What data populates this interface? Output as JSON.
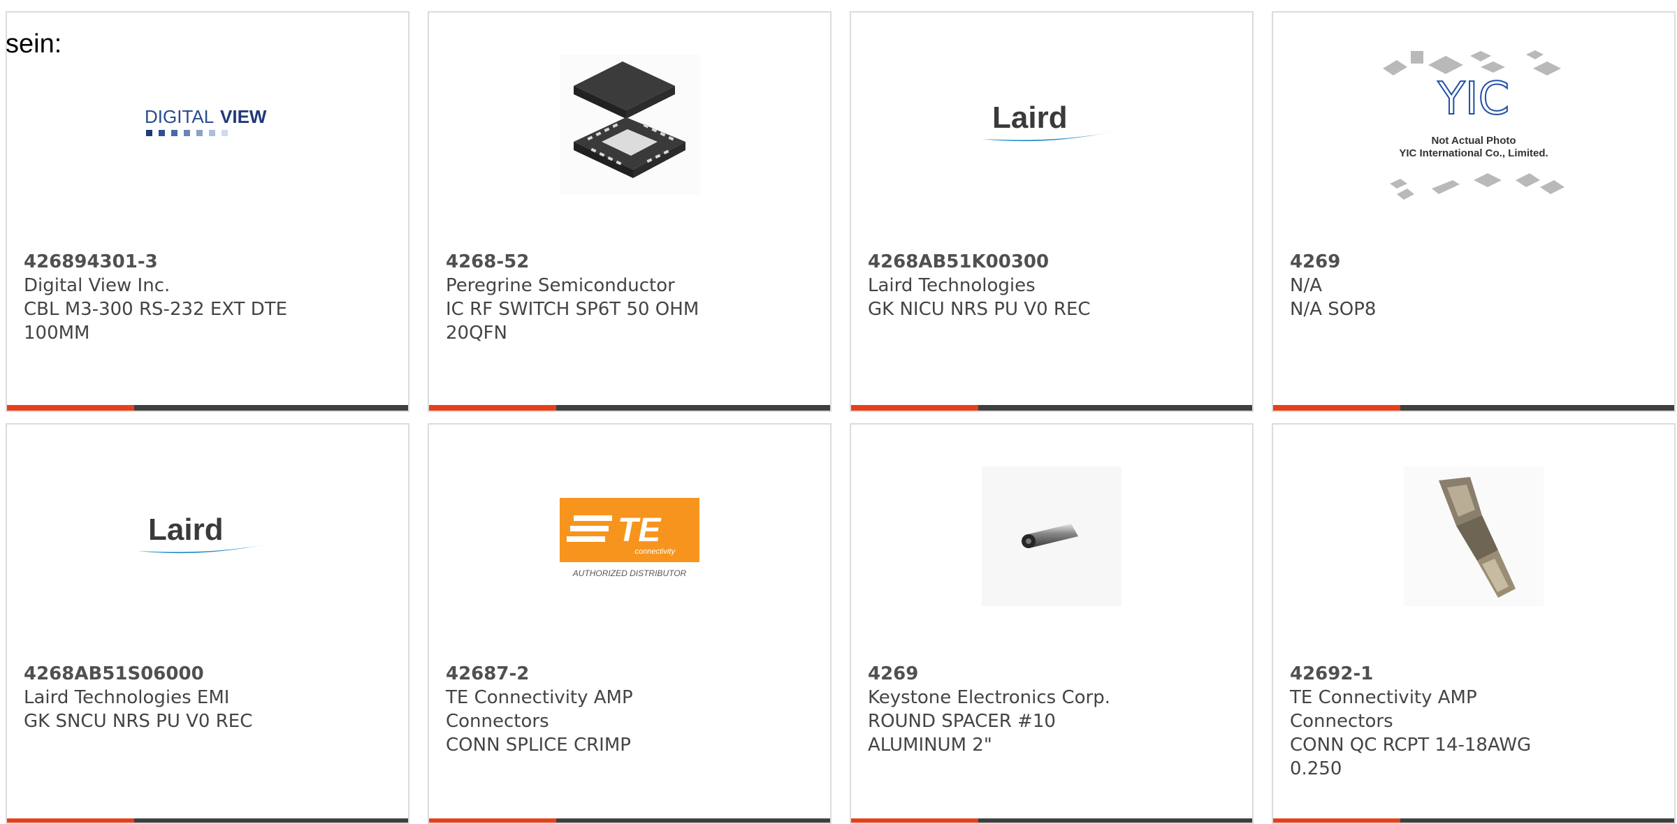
{
  "lead_text": "sein:",
  "colors": {
    "accent": "#e6401a",
    "bar": "#3f3f3f",
    "border": "#dcdcdc",
    "text": "#444444"
  },
  "products": [
    {
      "part_number": "426894301-3",
      "manufacturer": "Digital View Inc.",
      "description": "CBL M3-300 RS-232 EXT DTE 100MM",
      "image": "digitalview-logo",
      "logo_text": {
        "a": "DIGITAL",
        "b": "VIEW"
      }
    },
    {
      "part_number": "4268-52",
      "manufacturer": "Peregrine Semiconductor",
      "description": "IC RF SWITCH SP6T 50 OHM 20QFN",
      "image": "qfn-chip-icon"
    },
    {
      "part_number": "4268AB51K00300",
      "manufacturer": "Laird Technologies",
      "description": "GK NICU NRS PU V0 REC",
      "image": "laird-logo",
      "logo_text": "Laird"
    },
    {
      "part_number": "4269",
      "manufacturer": "N/A",
      "description": "N/A SOP8",
      "image": "yic-placeholder",
      "logo_text": {
        "mark": "YIC",
        "line1": "Not Actual Photo",
        "line2": "YIC International Co., Limited."
      }
    },
    {
      "part_number": "4268AB51S06000",
      "manufacturer": "Laird Technologies EMI",
      "description": "GK SNCU NRS PU V0 REC",
      "image": "laird-logo",
      "logo_text": "Laird"
    },
    {
      "part_number": "42687-2",
      "manufacturer": "TE Connectivity AMP Connectors",
      "description": "CONN SPLICE CRIMP",
      "image": "te-logo",
      "logo_text": {
        "mark": "TE",
        "sub": "connectivity",
        "caption": "AUTHORIZED DISTRIBUTOR"
      }
    },
    {
      "part_number": "4269",
      "manufacturer": "Keystone Electronics Corp.",
      "description": "ROUND SPACER #10 ALUMINUM 2\"",
      "image": "spacer-photo-icon"
    },
    {
      "part_number": "42692-1",
      "manufacturer": "TE Connectivity AMP Connectors",
      "description": "CONN QC RCPT 14-18AWG 0.250",
      "image": "quick-connect-terminal-icon"
    }
  ]
}
